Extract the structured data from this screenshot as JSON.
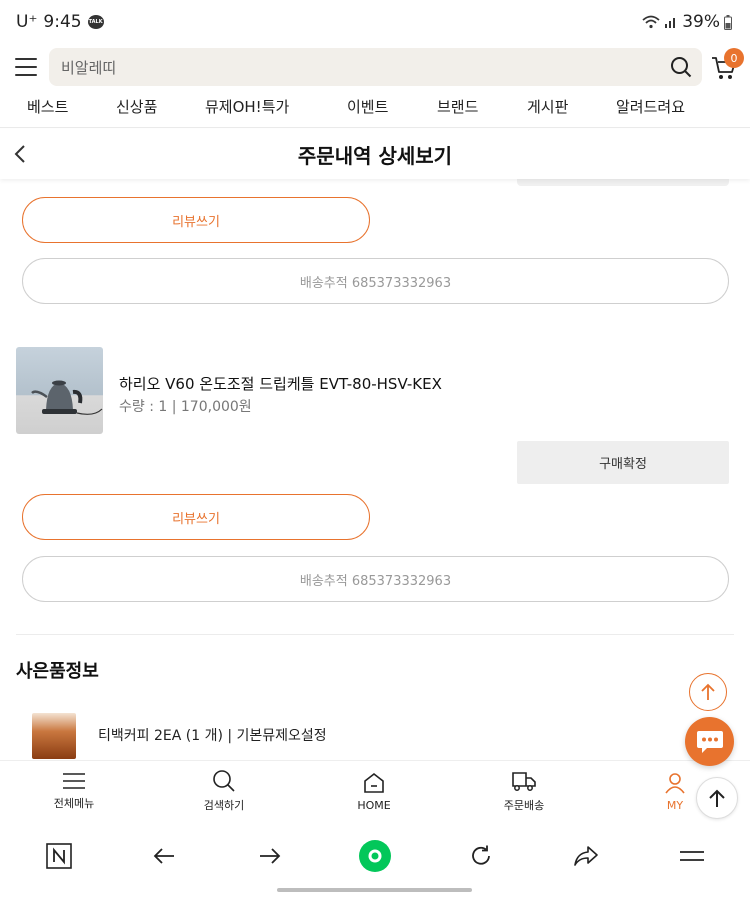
{
  "status_bar": {
    "carrier": "U⁺",
    "time": "9:45",
    "talk_badge": "TALK",
    "battery": "39%"
  },
  "search": {
    "placeholder": "비알레띠",
    "cart_count": "0"
  },
  "category_nav": [
    "베스트",
    "신상품",
    "뮤제OH!특가",
    "이벤트",
    "브랜드",
    "게시판",
    "알려드려요"
  ],
  "page": {
    "title": "주문내역 상세보기"
  },
  "orders": [
    {
      "review_label": "리뷰쓰기",
      "tracking_label": "배송추적 685373332963"
    },
    {
      "product_name": "하리오 V60 온도조절 드립케틀 EVT-80-HSV-KEX",
      "product_meta": "수량 : 1 | 170,000원",
      "confirm_label": "구매확정",
      "review_label": "리뷰쓰기",
      "tracking_label": "배송추적 685373332963"
    }
  ],
  "gift": {
    "section_title": "사은품정보",
    "item_text": "티백커피 2EA (1 개) | 기본뮤제오설정"
  },
  "bottom_tabs": [
    {
      "label": "전체메뉴",
      "icon": "menu-icon"
    },
    {
      "label": "검색하기",
      "icon": "search-icon"
    },
    {
      "label": "HOME",
      "icon": "home-icon"
    },
    {
      "label": "주문배송",
      "icon": "truck-icon"
    },
    {
      "label": "MY",
      "icon": "user-icon",
      "active": true
    }
  ],
  "colors": {
    "accent": "#e8732e",
    "naver_green": "#03c75a"
  }
}
